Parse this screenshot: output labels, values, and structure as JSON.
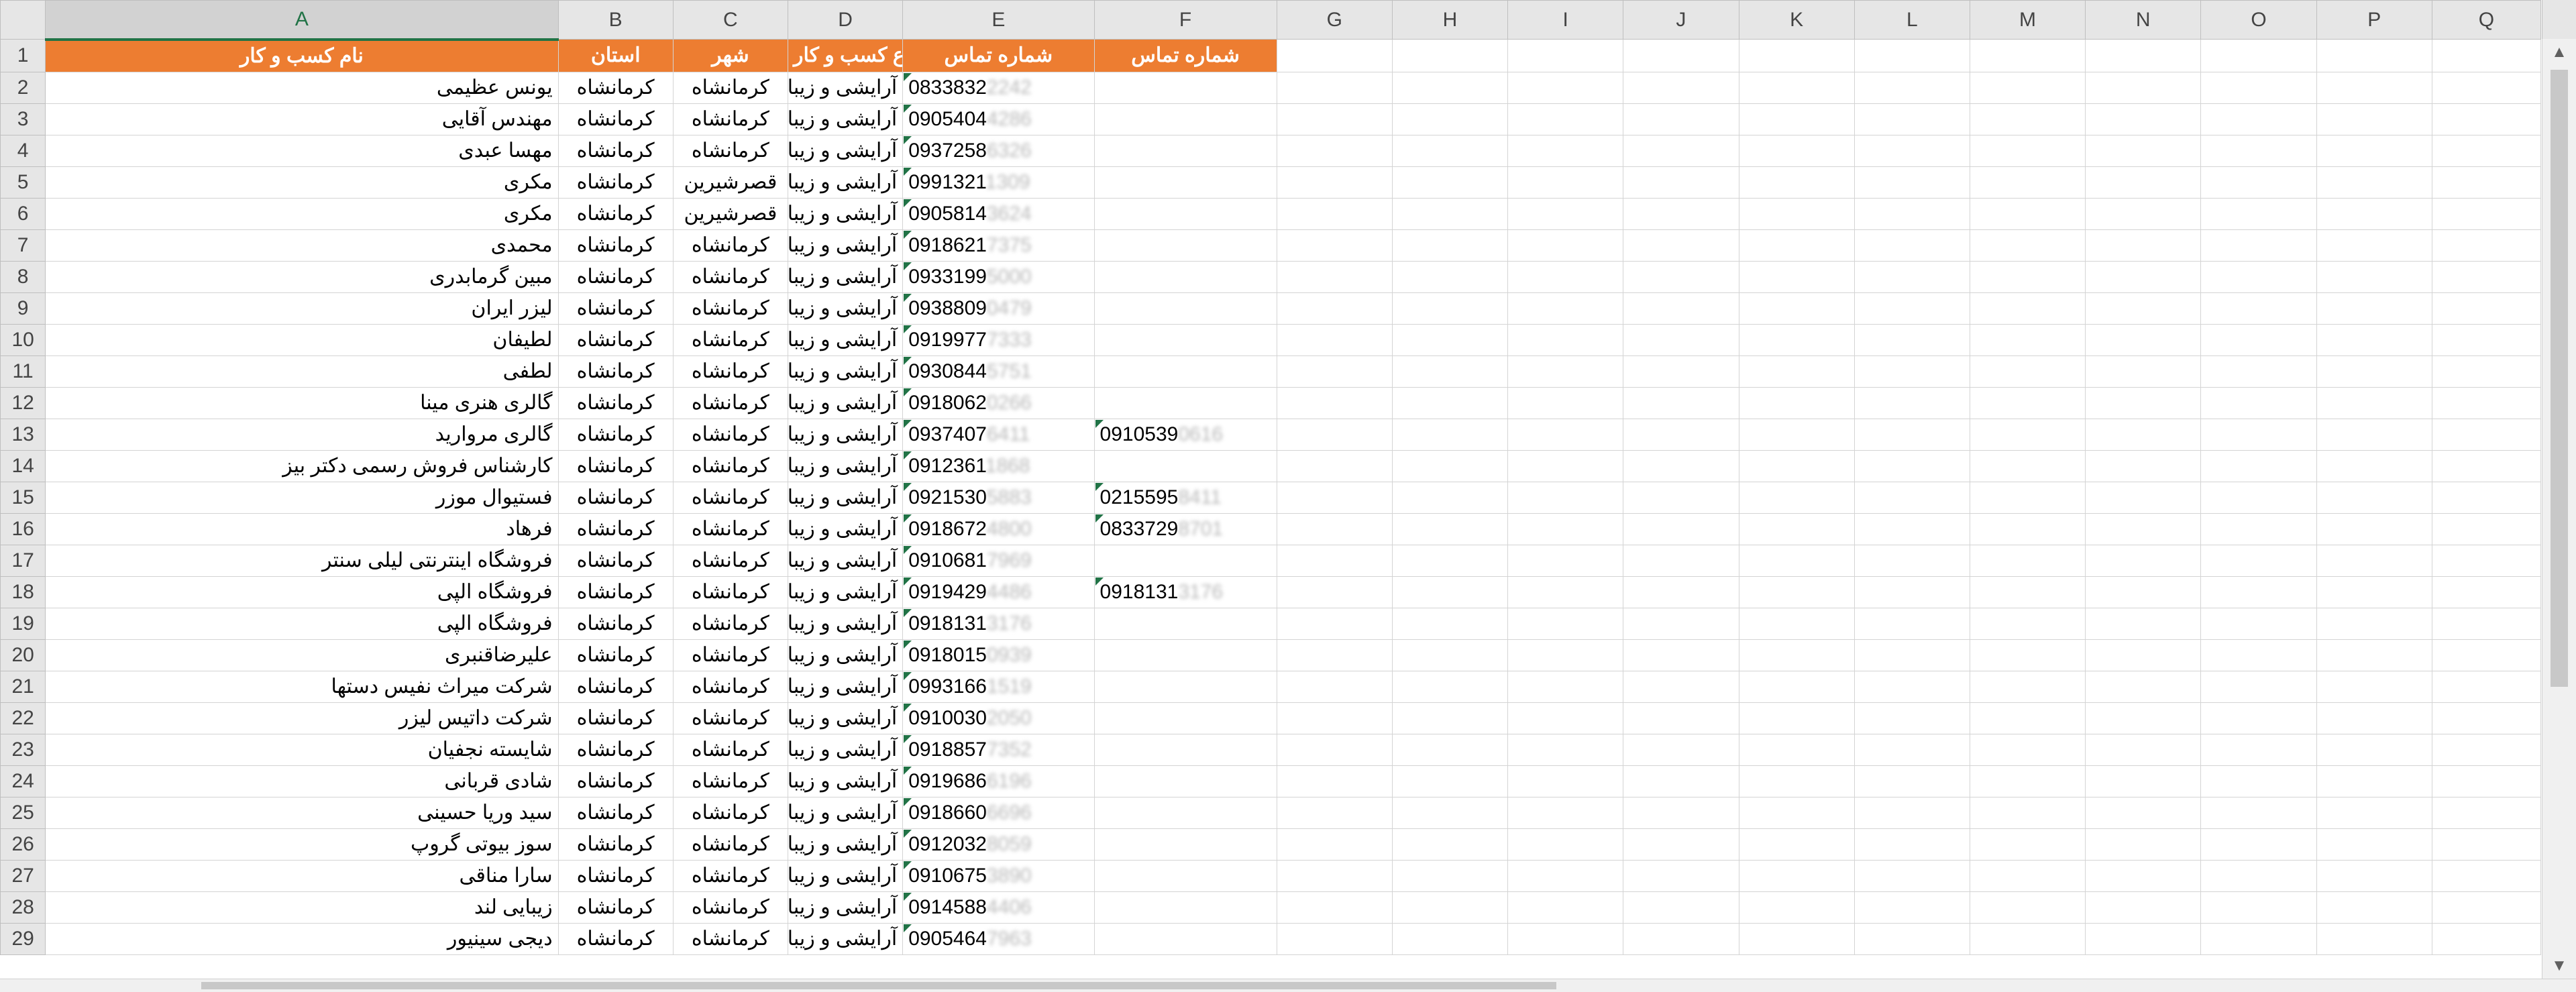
{
  "columns": [
    "A",
    "B",
    "C",
    "D",
    "E",
    "F",
    "G",
    "H",
    "I",
    "J",
    "K",
    "L",
    "M",
    "N",
    "O",
    "P",
    "Q"
  ],
  "selected_column": "A",
  "header_row": {
    "row_number": "1",
    "business_name": "نام کسب و کار",
    "province": "استان",
    "city": "شهر",
    "business_type": "نوع کسب و کار",
    "phone": "شماره تماس",
    "phone2": "شماره تماس"
  },
  "header_fill_color": "#ed7d31",
  "rows": [
    {
      "n": "2",
      "name": "یونس عظیمی",
      "prov": "کرمانشاه",
      "city": "کرمانشاه",
      "type": "آرایشی و زیبایی",
      "p1": "0833832",
      "p1b": "2242",
      "p2": "",
      "p2b": ""
    },
    {
      "n": "3",
      "name": "مهندس آقایی",
      "prov": "کرمانشاه",
      "city": "کرمانشاه",
      "type": "آرایشی و زیبایی",
      "p1": "0905404",
      "p1b": "4286",
      "p2": "",
      "p2b": ""
    },
    {
      "n": "4",
      "name": "مهسا عبدی",
      "prov": "کرمانشاه",
      "city": "کرمانشاه",
      "type": "آرایشی و زیبایی",
      "p1": "0937258",
      "p1b": "6326",
      "p2": "",
      "p2b": ""
    },
    {
      "n": "5",
      "name": "مکری",
      "prov": "کرمانشاه",
      "city": "قصرشیرین",
      "type": "آرایشی و زیبایی",
      "p1": "0991321",
      "p1b": "1309",
      "p2": "",
      "p2b": ""
    },
    {
      "n": "6",
      "name": "مکری",
      "prov": "کرمانشاه",
      "city": "قصرشیرین",
      "type": "آرایشی و زیبایی",
      "p1": "0905814",
      "p1b": "3624",
      "p2": "",
      "p2b": ""
    },
    {
      "n": "7",
      "name": "محمدی",
      "prov": "کرمانشاه",
      "city": "کرمانشاه",
      "type": "آرایشی و زیبایی",
      "p1": "0918621",
      "p1b": "7375",
      "p2": "",
      "p2b": ""
    },
    {
      "n": "8",
      "name": "مبین گرمابدری",
      "prov": "کرمانشاه",
      "city": "کرمانشاه",
      "type": "آرایشی و زیبایی",
      "p1": "0933199",
      "p1b": "5000",
      "p2": "",
      "p2b": ""
    },
    {
      "n": "9",
      "name": "لیزر ایران",
      "prov": "کرمانشاه",
      "city": "کرمانشاه",
      "type": "آرایشی و زیبایی",
      "p1": "0938809",
      "p1b": "0479",
      "p2": "",
      "p2b": ""
    },
    {
      "n": "10",
      "name": "لطیفان",
      "prov": "کرمانشاه",
      "city": "کرمانشاه",
      "type": "آرایشی و زیبایی",
      "p1": "0919977",
      "p1b": "7333",
      "p2": "",
      "p2b": ""
    },
    {
      "n": "11",
      "name": "لطفی",
      "prov": "کرمانشاه",
      "city": "کرمانشاه",
      "type": "آرایشی و زیبایی",
      "p1": "0930844",
      "p1b": "5751",
      "p2": "",
      "p2b": ""
    },
    {
      "n": "12",
      "name": "گالری هنری مینا",
      "prov": "کرمانشاه",
      "city": "کرمانشاه",
      "type": "آرایشی و زیبایی",
      "p1": "0918062",
      "p1b": "0266",
      "p2": "",
      "p2b": ""
    },
    {
      "n": "13",
      "name": "گالری مروارید",
      "prov": "کرمانشاه",
      "city": "کرمانشاه",
      "type": "آرایشی و زیبایی",
      "p1": "0937407",
      "p1b": "6411",
      "p2": "0910539",
      "p2b": "0616"
    },
    {
      "n": "14",
      "name": "کارشناس فروش رسمی دکتر بیز",
      "prov": "کرمانشاه",
      "city": "کرمانشاه",
      "type": "آرایشی و زیبایی",
      "p1": "0912361",
      "p1b": "1868",
      "p2": "",
      "p2b": ""
    },
    {
      "n": "15",
      "name": "فستیوال موزر",
      "prov": "کرمانشاه",
      "city": "کرمانشاه",
      "type": "آرایشی و زیبایی",
      "p1": "0921530",
      "p1b": "5883",
      "p2": "0215595",
      "p2b": "8411"
    },
    {
      "n": "16",
      "name": "فرهاد",
      "prov": "کرمانشاه",
      "city": "کرمانشاه",
      "type": "آرایشی و زیبایی",
      "p1": "0918672",
      "p1b": "4800",
      "p2": "0833729",
      "p2b": "8701"
    },
    {
      "n": "17",
      "name": "فروشگاه اینترنتی لیلی سنتر",
      "prov": "کرمانشاه",
      "city": "کرمانشاه",
      "type": "آرایشی و زیبایی",
      "p1": "0910681",
      "p1b": "7969",
      "p2": "",
      "p2b": ""
    },
    {
      "n": "18",
      "name": "فروشگاه الپی",
      "prov": "کرمانشاه",
      "city": "کرمانشاه",
      "type": "آرایشی و زیبایی",
      "p1": "0919429",
      "p1b": "4486",
      "p2": "0918131",
      "p2b": "3176"
    },
    {
      "n": "19",
      "name": "فروشگاه الپی",
      "prov": "کرمانشاه",
      "city": "کرمانشاه",
      "type": "آرایشی و زیبایی",
      "p1": "0918131",
      "p1b": "3176",
      "p2": "",
      "p2b": ""
    },
    {
      "n": "20",
      "name": "علیرضاقنبری",
      "prov": "کرمانشاه",
      "city": "کرمانشاه",
      "type": "آرایشی و زیبایی",
      "p1": "0918015",
      "p1b": "0939",
      "p2": "",
      "p2b": ""
    },
    {
      "n": "21",
      "name": "شرکت میراث نفیس دستها",
      "prov": "کرمانشاه",
      "city": "کرمانشاه",
      "type": "آرایشی و زیبایی",
      "p1": "0993166",
      "p1b": "1519",
      "p2": "",
      "p2b": ""
    },
    {
      "n": "22",
      "name": "شرکت داتیس لیزر",
      "prov": "کرمانشاه",
      "city": "کرمانشاه",
      "type": "آرایشی و زیبایی",
      "p1": "0910030",
      "p1b": "2050",
      "p2": "",
      "p2b": ""
    },
    {
      "n": "23",
      "name": "شایسته نجفیان",
      "prov": "کرمانشاه",
      "city": "کرمانشاه",
      "type": "آرایشی و زیبایی",
      "p1": "0918857",
      "p1b": "7352",
      "p2": "",
      "p2b": ""
    },
    {
      "n": "24",
      "name": "شادی قربانی",
      "prov": "کرمانشاه",
      "city": "کرمانشاه",
      "type": "آرایشی و زیبایی",
      "p1": "0919686",
      "p1b": "6196",
      "p2": "",
      "p2b": ""
    },
    {
      "n": "25",
      "name": "سید وریا حسینی",
      "prov": "کرمانشاه",
      "city": "کرمانشاه",
      "type": "آرایشی و زیبایی",
      "p1": "0918660",
      "p1b": "6696",
      "p2": "",
      "p2b": ""
    },
    {
      "n": "26",
      "name": "سوز بیوتی گروپ",
      "prov": "کرمانشاه",
      "city": "کرمانشاه",
      "type": "آرایشی و زیبایی",
      "p1": "0912032",
      "p1b": "8059",
      "p2": "",
      "p2b": ""
    },
    {
      "n": "27",
      "name": "سارا مناقی",
      "prov": "کرمانشاه",
      "city": "کرمانشاه",
      "type": "آرایشی و زیبایی",
      "p1": "0910675",
      "p1b": "3890",
      "p2": "",
      "p2b": ""
    },
    {
      "n": "28",
      "name": "زیبایی لند",
      "prov": "کرمانشاه",
      "city": "کرمانشاه",
      "type": "آرایشی و زیبایی",
      "p1": "0914588",
      "p1b": "4406",
      "p2": "",
      "p2b": ""
    },
    {
      "n": "29",
      "name": "دیجی سینیور",
      "prov": "کرمانشاه",
      "city": "کرمانشاه",
      "type": "آرایشی و زیبایی",
      "p1": "0905464",
      "p1b": "7963",
      "p2": "",
      "p2b": ""
    }
  ],
  "scroll_up_glyph": "▲",
  "scroll_down_glyph": "▼"
}
